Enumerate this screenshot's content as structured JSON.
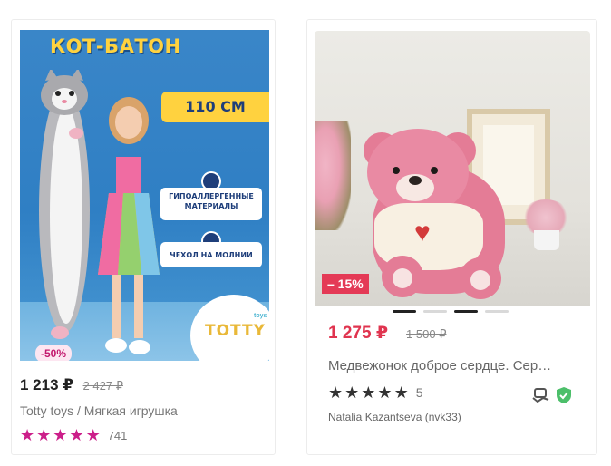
{
  "products": [
    {
      "image_banner": {
        "headline": "КОТ-БАТОН",
        "size": "110 СМ",
        "feature_1": "ГИПОАЛЛЕРГЕННЫЕ МАТЕРИАЛЫ",
        "feature_2": "ЧЕХОЛ НА МОЛНИИ",
        "brand_logo": "TOTTY",
        "brand_small": "toys"
      },
      "discount": "-50%",
      "price": "1 213 ₽",
      "old_price": "2 427 ₽",
      "title": "Totty toys / Мягкая игрушка",
      "rating": 5,
      "reviews": "741",
      "star_color": "#cc1f8a"
    },
    {
      "discount": "– 15%",
      "price": "1 275 ₽",
      "old_price": "1 500 ₽",
      "title": "Медвежонок доброе сердце. Сер…",
      "rating": 5,
      "rating_label": "5",
      "seller": "Natalia Kazantseva (nvk33)",
      "carousel_dots": 4,
      "carousel_active": [
        0,
        2
      ],
      "price_color": "#e0344f",
      "icons": [
        "handshake-icon",
        "shield-check-icon"
      ]
    }
  ]
}
